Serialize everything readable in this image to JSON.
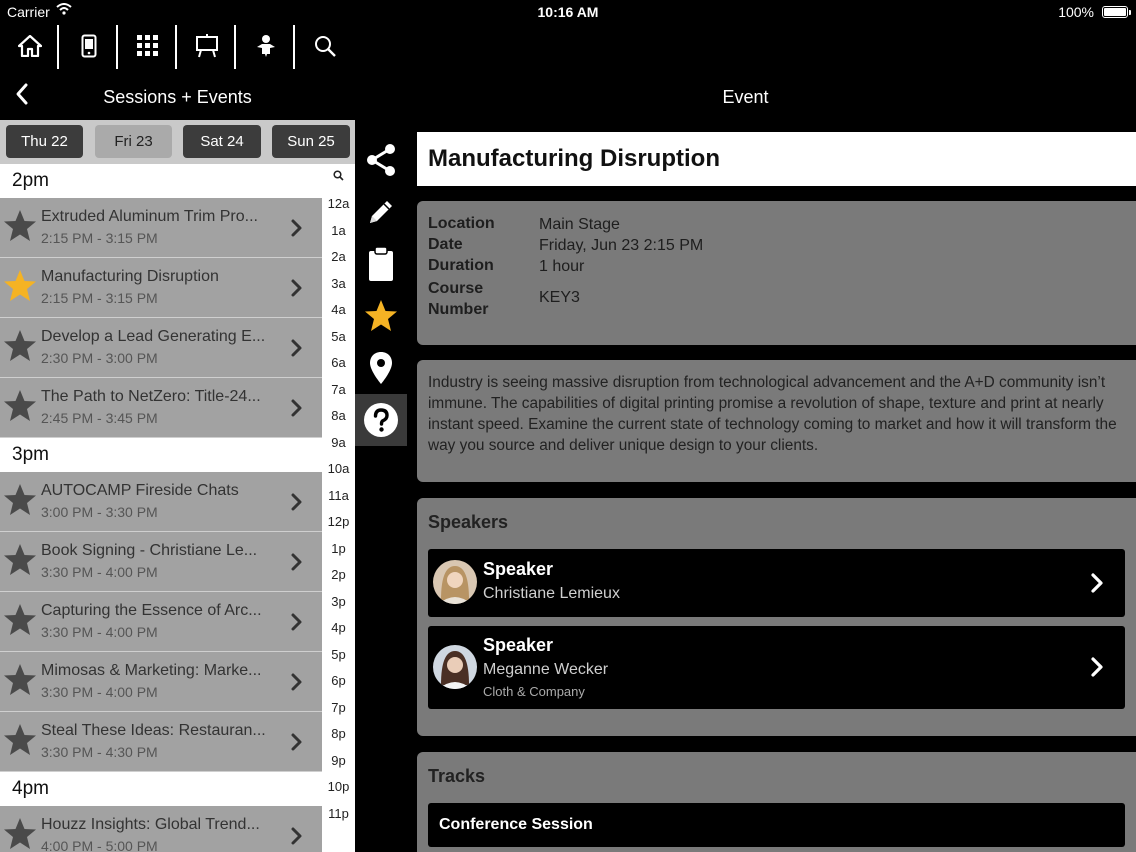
{
  "status": {
    "carrier": "Carrier",
    "time": "10:16 AM",
    "battery": "100%"
  },
  "toolbar": {
    "icons": [
      "home-icon",
      "phone-icon",
      "qr-code-icon",
      "presentation-board-icon",
      "speaker-person-icon",
      "search-icon"
    ]
  },
  "left_nav": {
    "title": "Sessions + Events",
    "back_icon": "chevron-left-icon"
  },
  "days": [
    {
      "label": "Thu 22",
      "selected": false
    },
    {
      "label": "Fri 23",
      "selected": true
    },
    {
      "label": "Sat 24",
      "selected": false
    },
    {
      "label": "Sun 25",
      "selected": false
    }
  ],
  "sections": [
    {
      "header": "2pm",
      "rows": [
        {
          "title": "Extruded Aluminum Trim Pro...",
          "time": "2:15 PM - 3:15 PM",
          "starred": false
        },
        {
          "title": "Manufacturing Disruption",
          "time": "2:15 PM - 3:15 PM",
          "starred": true
        },
        {
          "title": "Develop a Lead Generating E...",
          "time": "2:30 PM - 3:00 PM",
          "starred": false
        },
        {
          "title": "The Path to NetZero: Title-24...",
          "time": "2:45 PM - 3:45 PM",
          "starred": false
        }
      ]
    },
    {
      "header": "3pm",
      "rows": [
        {
          "title": "AUTOCAMP Fireside Chats",
          "time": "3:00 PM - 3:30 PM",
          "starred": false
        },
        {
          "title": "Book Signing - Christiane Le...",
          "time": "3:30 PM - 4:00 PM",
          "starred": false
        },
        {
          "title": "Capturing the Essence of Arc...",
          "time": "3:30 PM - 4:00 PM",
          "starred": false
        },
        {
          "title": "Mimosas & Marketing: Marke...",
          "time": "3:30 PM - 4:00 PM",
          "starred": false
        },
        {
          "title": "Steal These Ideas: Restauran...",
          "time": "3:30 PM - 4:30 PM",
          "starred": false
        }
      ]
    },
    {
      "header": "4pm",
      "rows": [
        {
          "title": "Houzz Insights: Global Trend...",
          "time": "4:00 PM - 5:00 PM",
          "starred": false
        }
      ]
    }
  ],
  "hour_index": [
    "12a",
    "1a",
    "2a",
    "3a",
    "4a",
    "5a",
    "6a",
    "7a",
    "8a",
    "9a",
    "10a",
    "11a",
    "12p",
    "1p",
    "2p",
    "3p",
    "4p",
    "5p",
    "6p",
    "7p",
    "8p",
    "9p",
    "10p",
    "11p"
  ],
  "actions": {
    "icons": [
      "share-icon",
      "pencil-icon",
      "clipboard-icon",
      "star-icon",
      "map-pin-icon",
      "help-icon"
    ],
    "active": "help-icon"
  },
  "event": {
    "nav_title": "Event",
    "title": "Manufacturing Disruption",
    "labels": {
      "location": "Location",
      "date": "Date",
      "duration": "Duration",
      "course_number": "Course\nNumber"
    },
    "values": {
      "location": "Main Stage",
      "date": "Friday, Jun 23 2:15 PM",
      "duration": "1 hour",
      "course_number": "KEY3"
    },
    "description": "Industry is seeing massive disruption from technological advancement and the A+D community isn’t immune. The capabilities of digital printing promise a revolution of shape, texture and print at nearly instant speed. Examine the current state of technology coming to market and how it will transform the way you source and deliver unique design to your clients.",
    "speakers_title": "Speakers",
    "speakers": [
      {
        "label": "Speaker",
        "name": "Christiane Lemieux",
        "company": ""
      },
      {
        "label": "Speaker",
        "name": "Meganne Wecker",
        "company": "Cloth & Company"
      }
    ],
    "tracks_title": "Tracks",
    "tracks": [
      "Conference Session"
    ]
  },
  "colors": {
    "star_active": "#f5b324",
    "star_inactive": "#4a4a4a",
    "row_bg": "#a2a2a2",
    "card_bg": "#7a7a7a"
  }
}
